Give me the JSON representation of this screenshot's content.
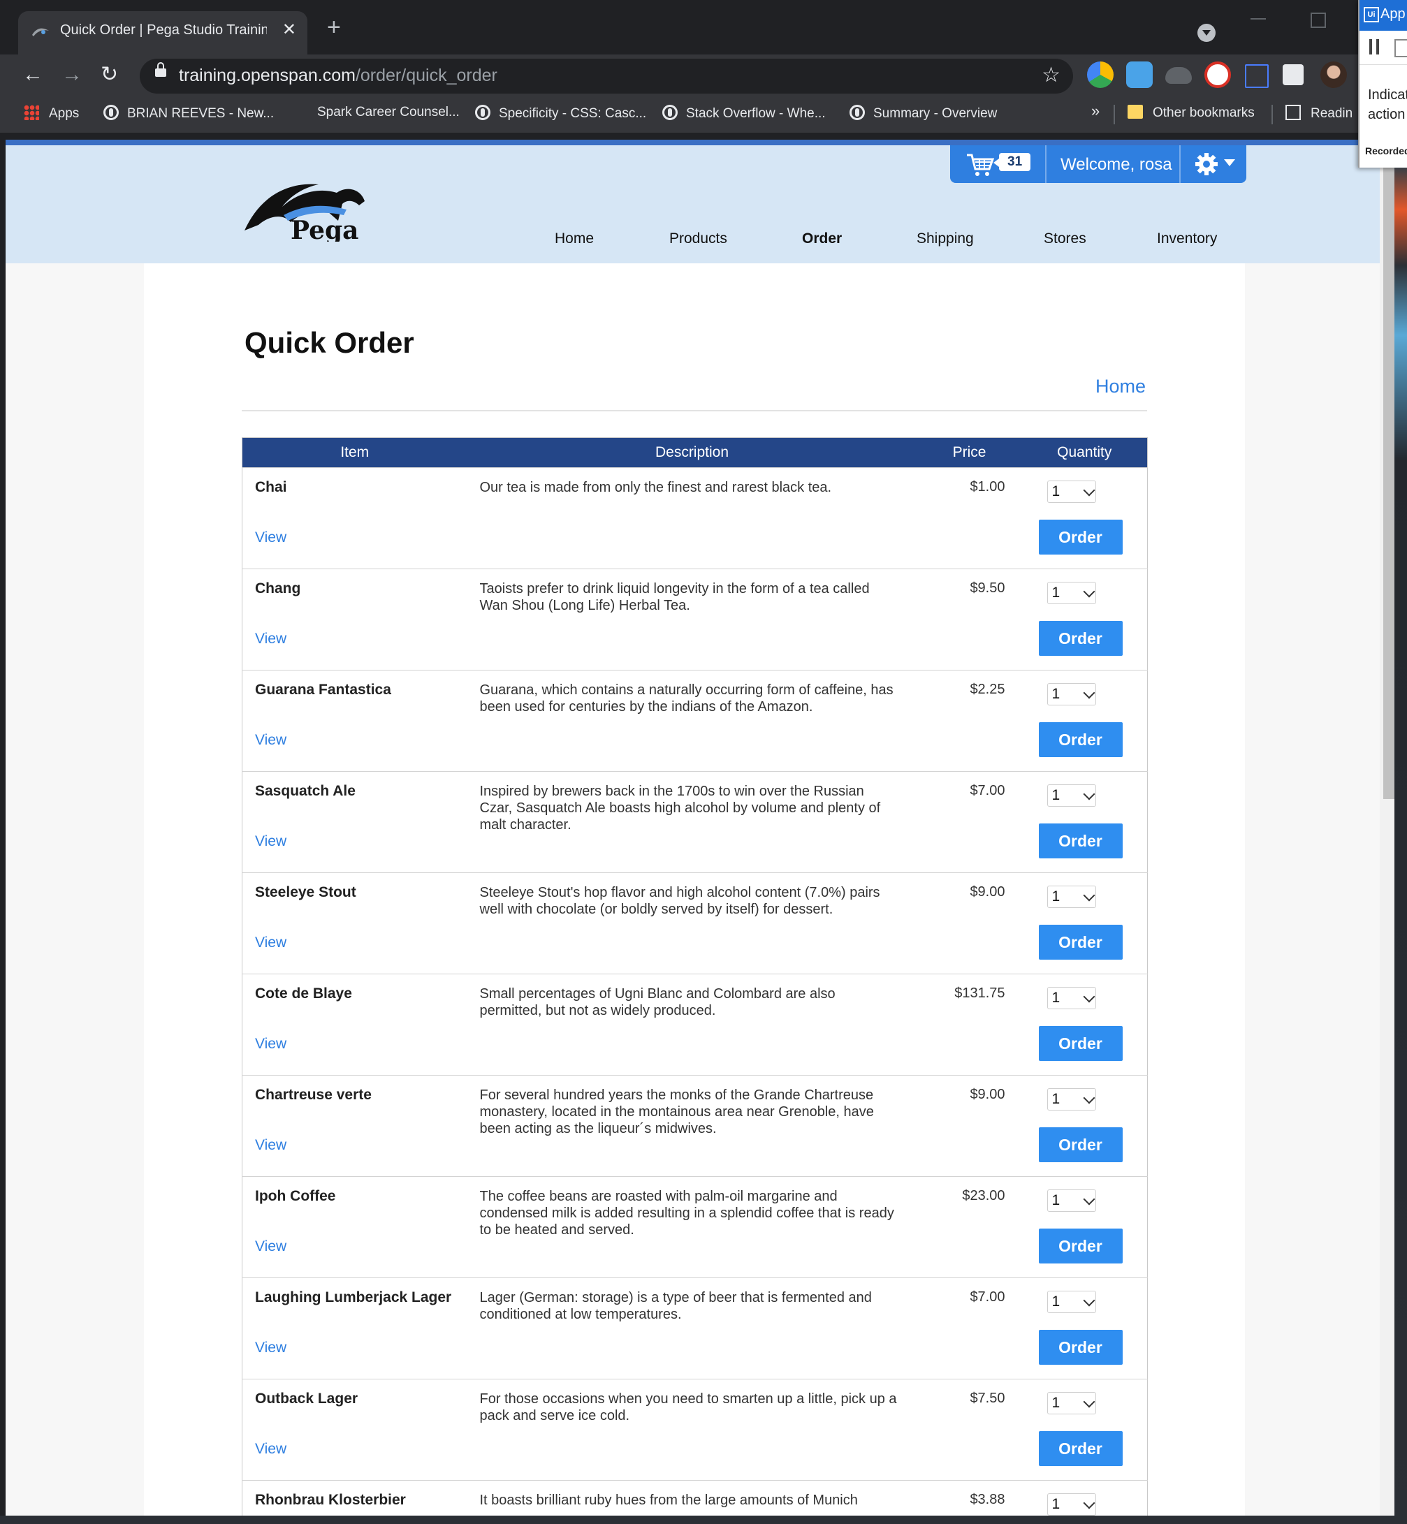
{
  "browser": {
    "tab_title": "Quick Order | Pega Studio Training W",
    "new_tab_glyph": "+",
    "url_host": "training.openspan.com",
    "url_path": "/order/quick_order",
    "bookmarks": [
      "Apps",
      "BRIAN REEVES - New...",
      "Spark Career Counsel...",
      "Specificity - CSS: Casc...",
      "Stack Overflow - Whe...",
      "Summary - Overview"
    ],
    "bookmarks_overflow": "»",
    "other_bookmarks": "Other bookmarks",
    "reading_list": "Readin"
  },
  "header": {
    "cart_count": "31",
    "welcome": "Welcome, rosa",
    "nav": [
      "Home",
      "Products",
      "Order",
      "Shipping",
      "Stores",
      "Inventory"
    ],
    "active_nav": "Order",
    "brand_color": "#2f7fe0",
    "header_bg": "#d6e6f5"
  },
  "page": {
    "title": "Quick Order",
    "breadcrumb_home": "Home"
  },
  "table": {
    "headers": [
      "Item",
      "Description",
      "Price",
      "Quantity"
    ],
    "header_bg": "#244688",
    "view_label": "View",
    "order_label": "Order",
    "qty_value": "1",
    "rows": [
      {
        "item": "Chai",
        "description": "Our tea is made from only the finest and rarest black tea.",
        "price": "$1.00"
      },
      {
        "item": "Chang",
        "description": "Taoists prefer to drink liquid longevity in the form of a tea called Wan Shou (Long Life) Herbal Tea.",
        "price": "$9.50"
      },
      {
        "item": "Guarana Fantastica",
        "description": "Guarana, which contains a naturally occurring form of caffeine, has been used for centuries by the indians of the Amazon.",
        "price": "$2.25"
      },
      {
        "item": "Sasquatch Ale",
        "description": "Inspired by brewers back in the 1700s to win over the Russian Czar, Sasquatch Ale boasts high alcohol by volume and plenty of malt character.",
        "price": "$7.00"
      },
      {
        "item": "Steeleye Stout",
        "description": "Steeleye Stout's hop flavor and high alcohol content (7.0%) pairs well with chocolate (or boldly served by itself) for dessert.",
        "price": "$9.00"
      },
      {
        "item": "Cote de Blaye",
        "description": "Small percentages of Ugni Blanc and Colombard are also permitted, but not as widely produced.",
        "price": "$131.75"
      },
      {
        "item": "Chartreuse verte",
        "description": "For several hundred years the monks of the Grande Chartreuse monastery, located in the montainous area near Grenoble, have been acting as the liqueur´s midwives.",
        "price": "$9.00"
      },
      {
        "item": "Ipoh Coffee",
        "description": "The coffee beans are roasted with palm-oil margarine and condensed milk is added resulting in a splendid coffee that is ready to be heated and served.",
        "price": "$23.00"
      },
      {
        "item": "Laughing Lumberjack Lager",
        "description": "Lager (German: storage) is a type of beer that is fermented and conditioned at low temperatures.",
        "price": "$7.00"
      },
      {
        "item": "Outback Lager",
        "description": "For those occasions when you need to smarten up a little, pick up a pack and serve ice cold.",
        "price": "$7.50"
      },
      {
        "item": "Rhonbrau Klosterbier",
        "description": "It boasts brilliant ruby hues from the large amounts of Munich",
        "price": "$3.88"
      }
    ]
  },
  "recorder": {
    "title": "App",
    "line1": "Indicate",
    "line2": "action",
    "status": "Recorded"
  }
}
